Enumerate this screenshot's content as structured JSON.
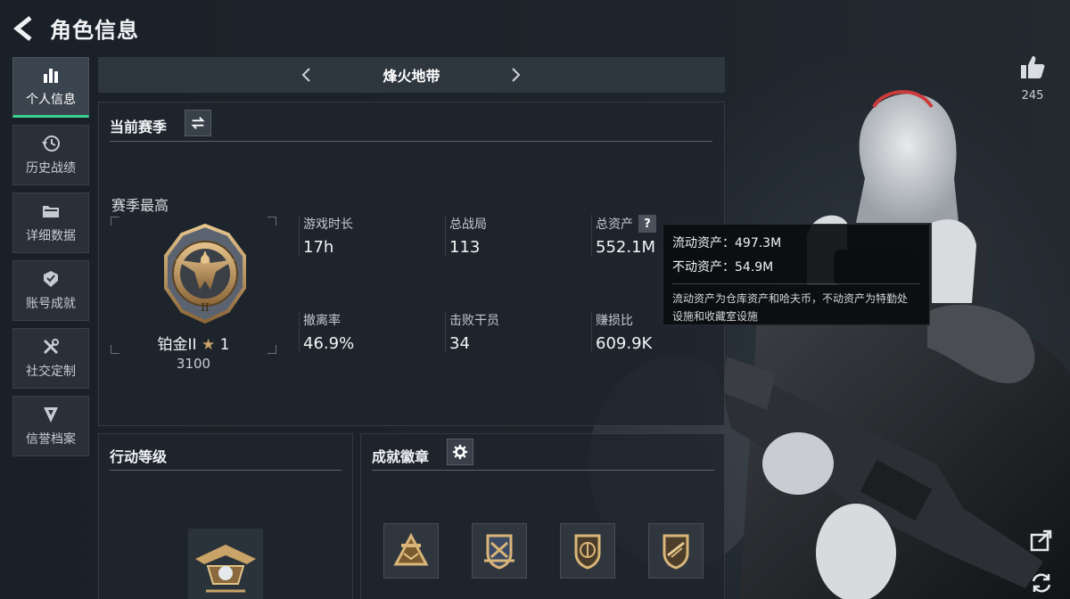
{
  "header": {
    "title": "角色信息"
  },
  "sidebar": {
    "items": [
      {
        "label": "个人信息",
        "icon": "bar-chart-icon",
        "active": true
      },
      {
        "label": "历史战绩",
        "icon": "history-clock-icon"
      },
      {
        "label": "详细数据",
        "icon": "folder-icon"
      },
      {
        "label": "账号成就",
        "icon": "achievement-icon"
      },
      {
        "label": "社交定制",
        "icon": "tools-icon"
      },
      {
        "label": "信誉档案",
        "icon": "reputation-icon"
      }
    ]
  },
  "mode_switch": {
    "title": "烽火地带"
  },
  "season": {
    "title": "当前赛季",
    "best_label": "赛季最高",
    "rank": {
      "name": "铂金II",
      "stars": "1",
      "score": "3100",
      "emblem_numeral": "II"
    },
    "stats": [
      {
        "label": "游戏时长",
        "value": "17h"
      },
      {
        "label": "总战局",
        "value": "113"
      },
      {
        "label": "总资产",
        "value": "552.1M"
      },
      {
        "label": "撤离率",
        "value": "46.9%"
      },
      {
        "label": "击败干员",
        "value": "34"
      },
      {
        "label": "赚损比",
        "value": "609.9K"
      }
    ]
  },
  "tooltip": {
    "liquid": "流动资产：497.3M",
    "fixed": "不动资产：54.9M",
    "desc_line1": "流动资产为仓库资产和哈夫币，不动资产为特勤处",
    "desc_line2": "设施和收藏室设施"
  },
  "action_level": {
    "title": "行动等级"
  },
  "badges": {
    "title": "成就徽章",
    "items": [
      "badge-triangle-icon",
      "badge-crest-icon",
      "badge-shield-icon",
      "badge-rifle-icon"
    ]
  },
  "likes": {
    "count": "245"
  },
  "colors": {
    "accent": "#39d28d",
    "gold": "#c9a367",
    "panel": "#1e252c"
  }
}
